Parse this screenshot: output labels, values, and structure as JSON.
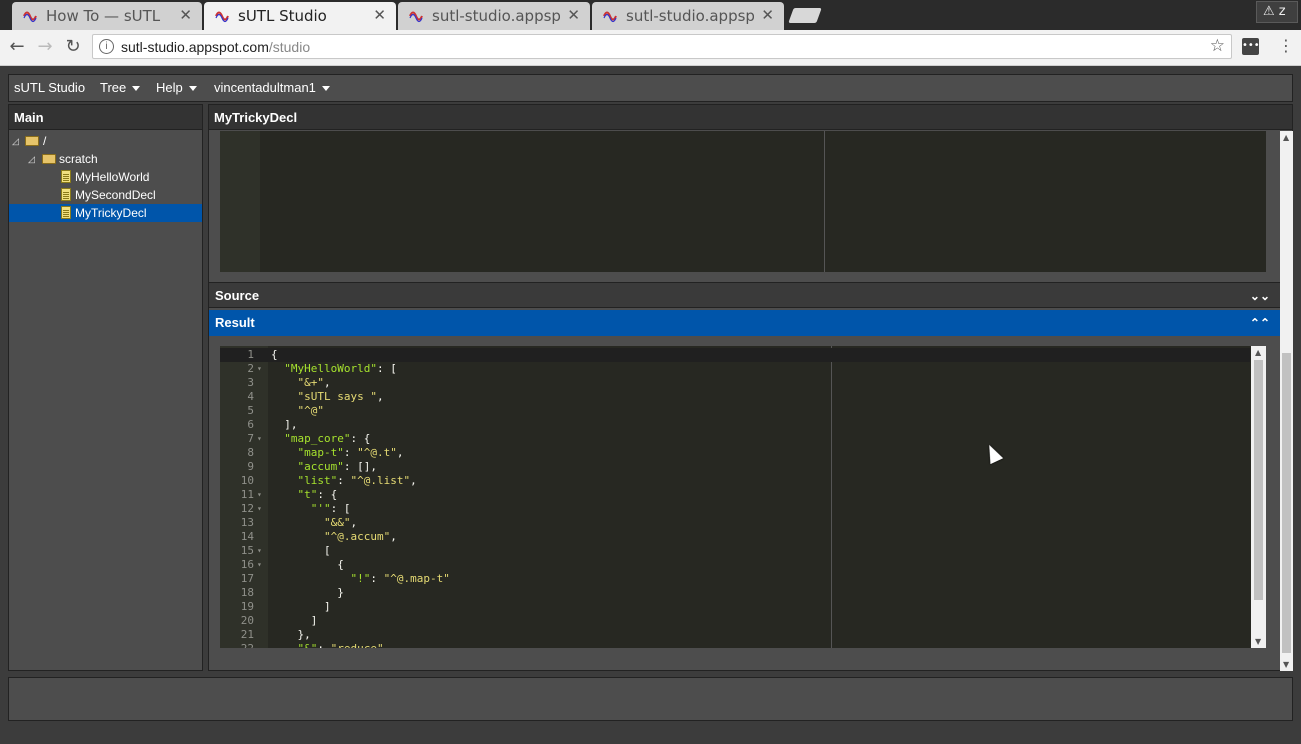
{
  "browser": {
    "tabs": [
      {
        "title": "How To — sUTL",
        "active": false
      },
      {
        "title": "sUTL Studio",
        "active": true
      },
      {
        "title": "sutl-studio.appspot",
        "active": false
      },
      {
        "title": "sutl-studio.appspot",
        "active": false
      }
    ],
    "close_glyph": "✕",
    "warning_text": "⚠ z",
    "url_host": "sutl-studio.appspot.com",
    "url_path": "/studio"
  },
  "app": {
    "menu": {
      "brand": "sUTL Studio",
      "tree": "Tree",
      "help": "Help",
      "user": "vincentadultman1"
    },
    "left_panel": {
      "title": "Main",
      "tree": [
        {
          "label": "/"
        },
        {
          "label": "scratch"
        },
        {
          "label": "MyHelloWorld"
        },
        {
          "label": "MySecondDecl"
        },
        {
          "label": "MyTrickyDecl",
          "selected": true
        }
      ]
    },
    "right_panel": {
      "title": "MyTrickyDecl",
      "source_label": "Source",
      "result_label": "Result"
    }
  },
  "result_lines": [
    {
      "n": "1",
      "code": "{"
    },
    {
      "n": "2",
      "code": "  \"MyHelloWorld\": ["
    },
    {
      "n": "3",
      "code": "    \"&+\","
    },
    {
      "n": "4",
      "code": "    \"sUTL says \","
    },
    {
      "n": "5",
      "code": "    \"^@\""
    },
    {
      "n": "6",
      "code": "  ],"
    },
    {
      "n": "7",
      "code": "  \"map_core\": {"
    },
    {
      "n": "8",
      "code": "    \"map-t\": \"^@.t\","
    },
    {
      "n": "9",
      "code": "    \"accum\": [],"
    },
    {
      "n": "10",
      "code": "    \"list\": \"^@.list\","
    },
    {
      "n": "11",
      "code": "    \"t\": {"
    },
    {
      "n": "12",
      "code": "      \"'\": ["
    },
    {
      "n": "13",
      "code": "        \"&&\","
    },
    {
      "n": "14",
      "code": "        \"^@.accum\","
    },
    {
      "n": "15",
      "code": "        ["
    },
    {
      "n": "16",
      "code": "          {"
    },
    {
      "n": "17",
      "code": "            \"!\": \"^@.map-t\""
    },
    {
      "n": "18",
      "code": "          }"
    },
    {
      "n": "19",
      "code": "        ]"
    },
    {
      "n": "20",
      "code": "      ]"
    },
    {
      "n": "21",
      "code": "    },"
    },
    {
      "n": "22",
      "code": "    \"&\": \"reduce\","
    }
  ]
}
